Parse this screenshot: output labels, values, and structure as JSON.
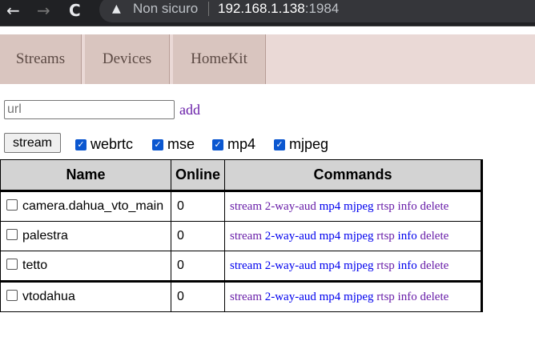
{
  "browser": {
    "back_icon": "←",
    "forward_icon": "→",
    "reload_icon": "C",
    "security_label": "Non sicuro",
    "url_host": "192.168.1.138",
    "url_port": ":1984"
  },
  "tabs": [
    {
      "label": "Streams"
    },
    {
      "label": "Devices"
    },
    {
      "label": "HomeKit"
    }
  ],
  "form": {
    "url_placeholder": "url",
    "url_value": "",
    "add_label": "add",
    "stream_button": "stream",
    "checkboxes": [
      {
        "label": "webrtc",
        "checked": true
      },
      {
        "label": "mse",
        "checked": true
      },
      {
        "label": "mp4",
        "checked": true
      },
      {
        "label": "mjpeg",
        "checked": true
      }
    ]
  },
  "table": {
    "headers": [
      "Name",
      "Online",
      "Commands"
    ],
    "rows": [
      {
        "name": "camera.dahua_vto_main",
        "online": "0",
        "commands": [
          {
            "label": "stream",
            "visited": true
          },
          {
            "label": "2-way-aud",
            "visited": true
          },
          {
            "label": "mp4",
            "visited": false
          },
          {
            "label": "mjpeg",
            "visited": false
          },
          {
            "label": "rtsp",
            "visited": true
          },
          {
            "label": "info",
            "visited": true
          },
          {
            "label": "delete",
            "visited": true
          }
        ]
      },
      {
        "name": "palestra",
        "online": "0",
        "commands": [
          {
            "label": "stream",
            "visited": true
          },
          {
            "label": "2-way-aud",
            "visited": false
          },
          {
            "label": "mp4",
            "visited": false
          },
          {
            "label": "mjpeg",
            "visited": false
          },
          {
            "label": "rtsp",
            "visited": true
          },
          {
            "label": "info",
            "visited": false
          },
          {
            "label": "delete",
            "visited": true
          }
        ]
      },
      {
        "name": "tetto",
        "online": "0",
        "commands": [
          {
            "label": "stream",
            "visited": false
          },
          {
            "label": "2-way-aud",
            "visited": false
          },
          {
            "label": "mp4",
            "visited": false
          },
          {
            "label": "mjpeg",
            "visited": false
          },
          {
            "label": "rtsp",
            "visited": true
          },
          {
            "label": "info",
            "visited": false
          },
          {
            "label": "delete",
            "visited": true
          }
        ]
      },
      {
        "name": "vtodahua",
        "online": "0",
        "commands": [
          {
            "label": "stream",
            "visited": true
          },
          {
            "label": "2-way-aud",
            "visited": false
          },
          {
            "label": "mp4",
            "visited": false
          },
          {
            "label": "mjpeg",
            "visited": false
          },
          {
            "label": "rtsp",
            "visited": true
          },
          {
            "label": "info",
            "visited": true
          },
          {
            "label": "delete",
            "visited": true
          }
        ]
      }
    ]
  },
  "colors": {
    "link": "#0000ee",
    "visited": "#681da8"
  }
}
